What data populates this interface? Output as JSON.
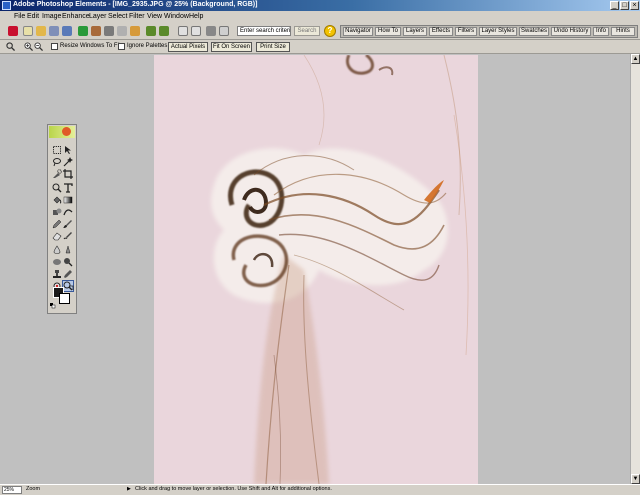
{
  "window": {
    "title": "Adobe Photoshop Elements - [IMG_2935.JPG @ 25% (Background, RGB)]",
    "controls": {
      "minimize": "_",
      "maximize": "□",
      "close": "×"
    }
  },
  "menubar": [
    "File",
    "Edit",
    "Image",
    "Enhance",
    "Layer",
    "Select",
    "Filter",
    "View",
    "Window",
    "Help"
  ],
  "shortcuts": {
    "search_value": "Enter search criteria",
    "search_button": "Search",
    "help": "?"
  },
  "palette_well": [
    "Navigator",
    "How To",
    "Layers",
    "Effects",
    "Filters",
    "Layer Styles",
    "Swatches",
    "Undo History",
    "Info",
    "Hints"
  ],
  "options_bar": {
    "resize_windows": "Resize Windows To Fit",
    "ignore_palettes": "Ignore Palettes",
    "actual_pixels": "Actual Pixels",
    "fit_on_screen": "Fit On Screen",
    "print_size": "Print Size"
  },
  "status": {
    "zoom": "25%",
    "tool": "Zoom",
    "hint": "Click and drag to move layer or selection.  Use Shift and Alt for additional options."
  },
  "colors": {
    "foreground": "#1a1a1a",
    "background": "#ffffff",
    "canvas": "#ead6dc",
    "smoke": "#7a4a24"
  }
}
